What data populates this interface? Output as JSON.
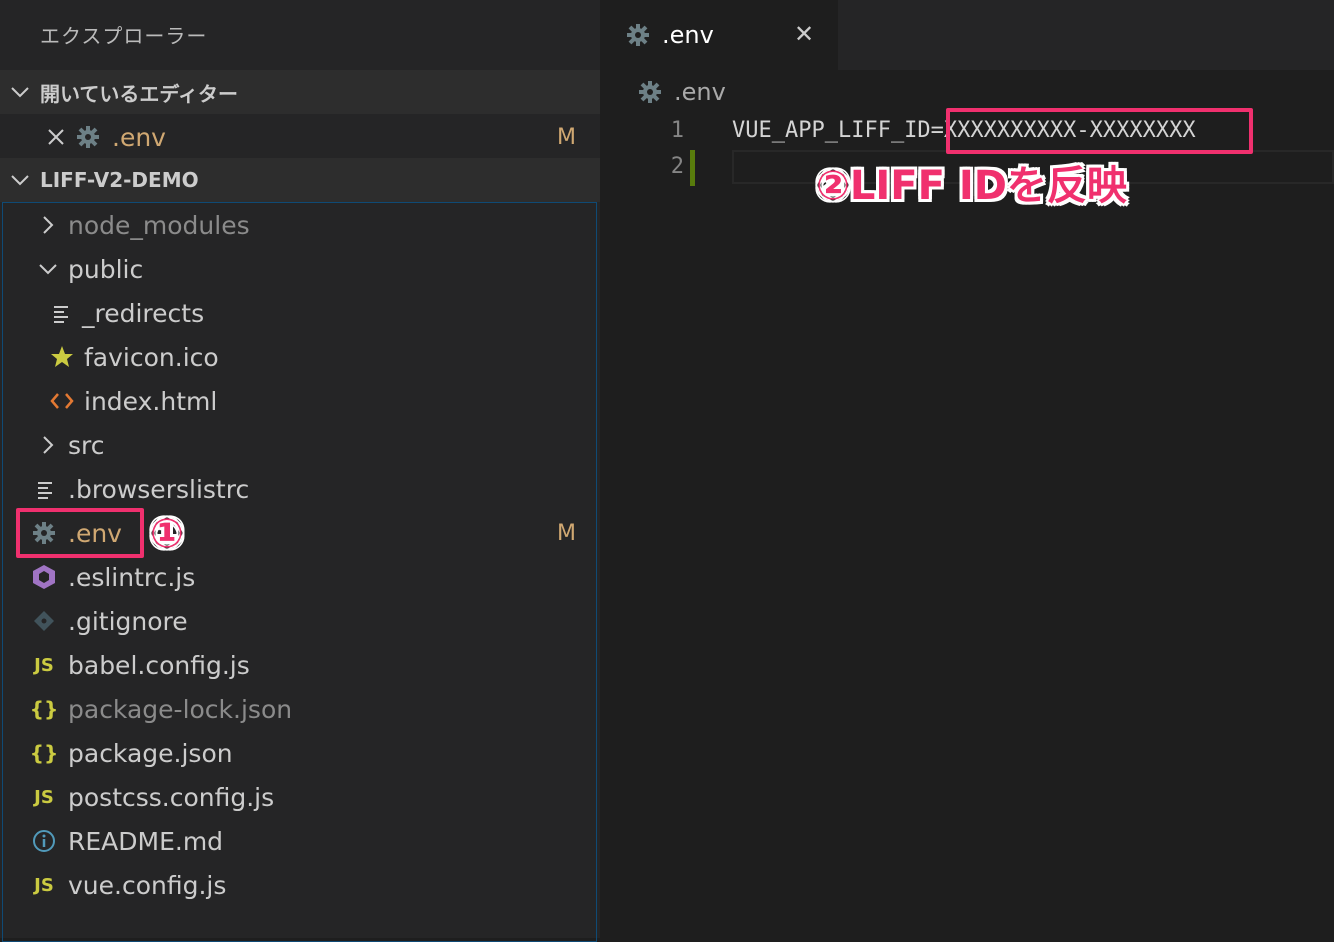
{
  "sidebar": {
    "title": "エクスプローラー",
    "open_editors": {
      "label": "開いているエディター",
      "items": [
        {
          "name": ".env",
          "badge": "M"
        }
      ]
    },
    "project": {
      "label": "LIFF-V2-DEMO",
      "items": [
        {
          "name": "node_modules",
          "type": "folder-collapsed"
        },
        {
          "name": "public",
          "type": "folder-expanded"
        },
        {
          "name": "_redirects",
          "type": "file-lines"
        },
        {
          "name": "favicon.ico",
          "type": "star"
        },
        {
          "name": "index.html",
          "type": "html"
        },
        {
          "name": "src",
          "type": "folder-collapsed"
        },
        {
          "name": ".browserslistrc",
          "type": "file-lines"
        },
        {
          "name": ".env",
          "type": "gear",
          "badge": "M"
        },
        {
          "name": ".eslintrc.js",
          "type": "eslint"
        },
        {
          "name": ".gitignore",
          "type": "git"
        },
        {
          "name": "babel.config.js",
          "type": "js"
        },
        {
          "name": "package-lock.json",
          "type": "json"
        },
        {
          "name": "package.json",
          "type": "json"
        },
        {
          "name": "postcss.config.js",
          "type": "js"
        },
        {
          "name": "README.md",
          "type": "info"
        },
        {
          "name": "vue.config.js",
          "type": "js"
        }
      ]
    }
  },
  "editor": {
    "tab": {
      "label": ".env",
      "close_glyph": "✕"
    },
    "breadcrumb": ".env",
    "lines": [
      {
        "num": "1",
        "text": "VUE_APP_LIFF_ID=XXXXXXXXXX-XXXXXXXX"
      },
      {
        "num": "2",
        "text": ""
      }
    ]
  },
  "annotations": {
    "step1": "①",
    "step2": "②LIFF IDを反映"
  },
  "colors": {
    "accent": "#f0306e",
    "modified": "#d0a872",
    "js": "#cbcb41",
    "html": "#e37933",
    "eslint": "#a074c4",
    "info": "#519aba"
  }
}
